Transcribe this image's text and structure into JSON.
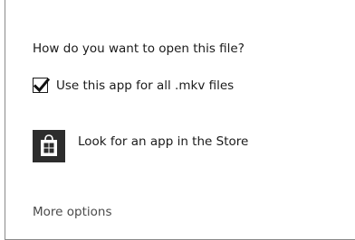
{
  "dialog": {
    "prompt": "How do you want to open this file?",
    "checkbox": {
      "label": "Use this app for all .mkv files",
      "checked": true
    },
    "store_option": {
      "label": "Look for an app in the Store",
      "icon": "store-bag-icon"
    },
    "more_options": "More options"
  }
}
